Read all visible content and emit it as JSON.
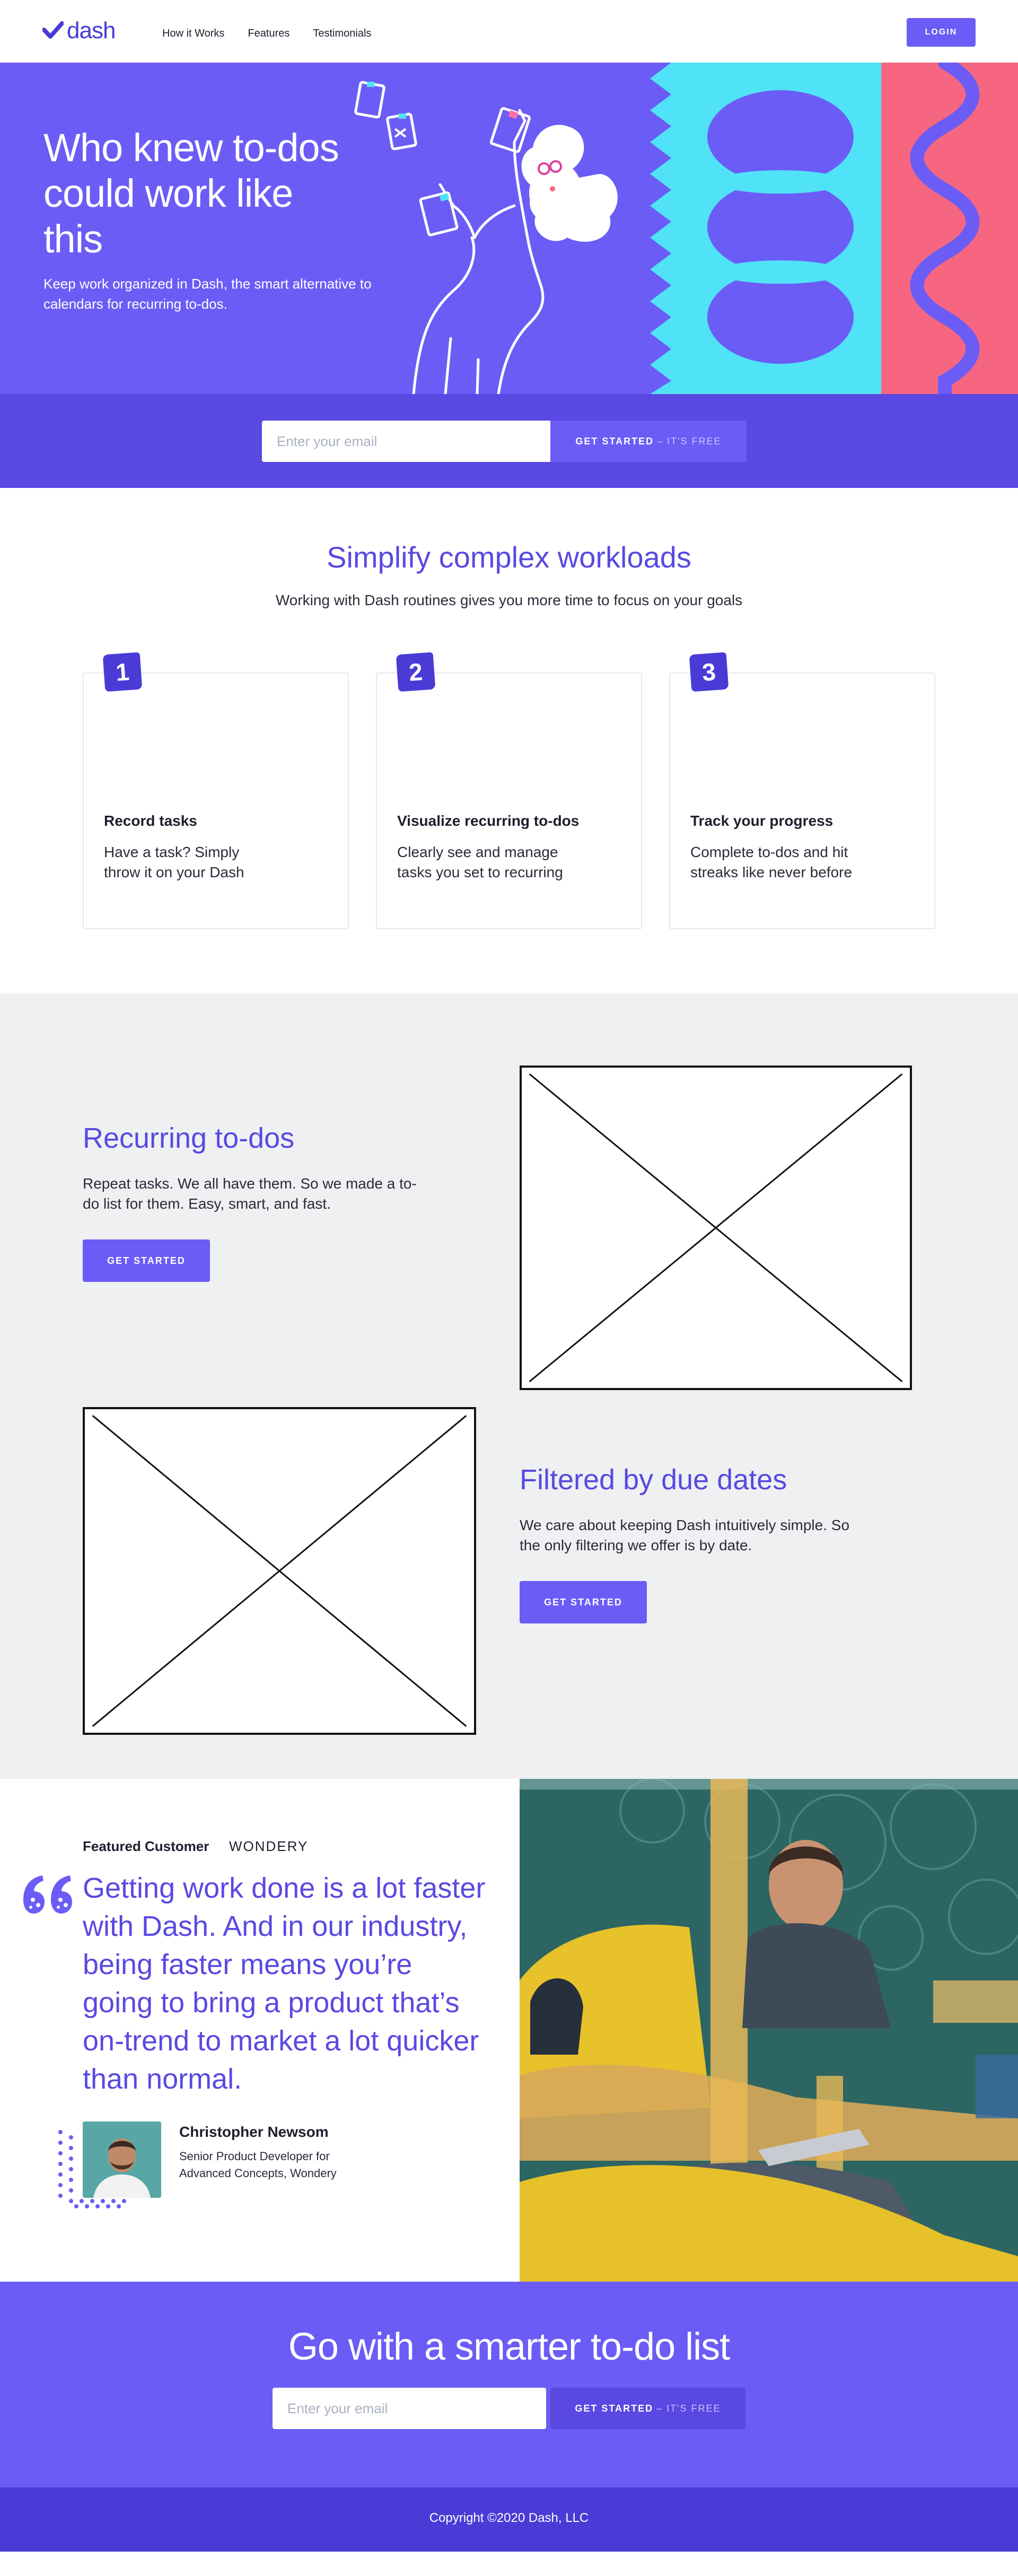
{
  "nav": {
    "logo_text": "dash",
    "links": [
      "How it Works",
      "Features",
      "Testimonials"
    ],
    "login_label": "LOGIN"
  },
  "hero": {
    "title": "Who knew to-dos could work like this",
    "subtitle": "Keep work organized in Dash, the smart alternative to calendars for recurring to-dos."
  },
  "signup": {
    "placeholder": "Enter your email",
    "button_label": "GET STARTED",
    "button_suffix": "– IT'S FREE"
  },
  "features": {
    "title": "Simplify complex workloads",
    "lead": "Working with Dash routines gives you more time to focus on your goals",
    "cards": [
      {
        "number": "1",
        "title": "Record tasks",
        "text": "Have a task? Simply throw it on your Dash"
      },
      {
        "number": "2",
        "title": "Visualize recurring to-dos",
        "text": "Clearly see and manage tasks you set to recurring"
      },
      {
        "number": "3",
        "title": "Track your progress",
        "text": "Complete to-dos and hit streaks like never before"
      }
    ]
  },
  "recurring": {
    "title": "Recurring to-dos",
    "text": "Repeat tasks. We all have them. So we made a to-do list for them. Easy, smart, and fast.",
    "button_label": "GET STARTED"
  },
  "filtered": {
    "title": "Filtered by due dates",
    "text": "We care about keeping Dash intuitively simple. So the only filtering we offer is by date.",
    "button_label": "GET STARTED"
  },
  "testimonial": {
    "featured_label": "Featured Customer",
    "brand": "WONDERY",
    "quote": "Getting work done is a lot faster with Dash. And in our industry, being faster means you’re going to bring a product that’s on-trend to market a lot quicker than normal.",
    "name": "Christopher Newsom",
    "role": "Senior Product Developer for Advanced Concepts, Wondery"
  },
  "cta": {
    "title": "Go with a smarter to-do list",
    "placeholder": "Enter your email",
    "button_label": "GET STARTED",
    "button_suffix": "– IT'S FREE"
  },
  "footer": {
    "copyright": "Copyright ©2020 Dash, LLC"
  },
  "colors": {
    "brand_purple": "#6b5cf6",
    "deep_purple": "#5a48e2",
    "cyan": "#50e3f7",
    "pink": "#f76680"
  }
}
